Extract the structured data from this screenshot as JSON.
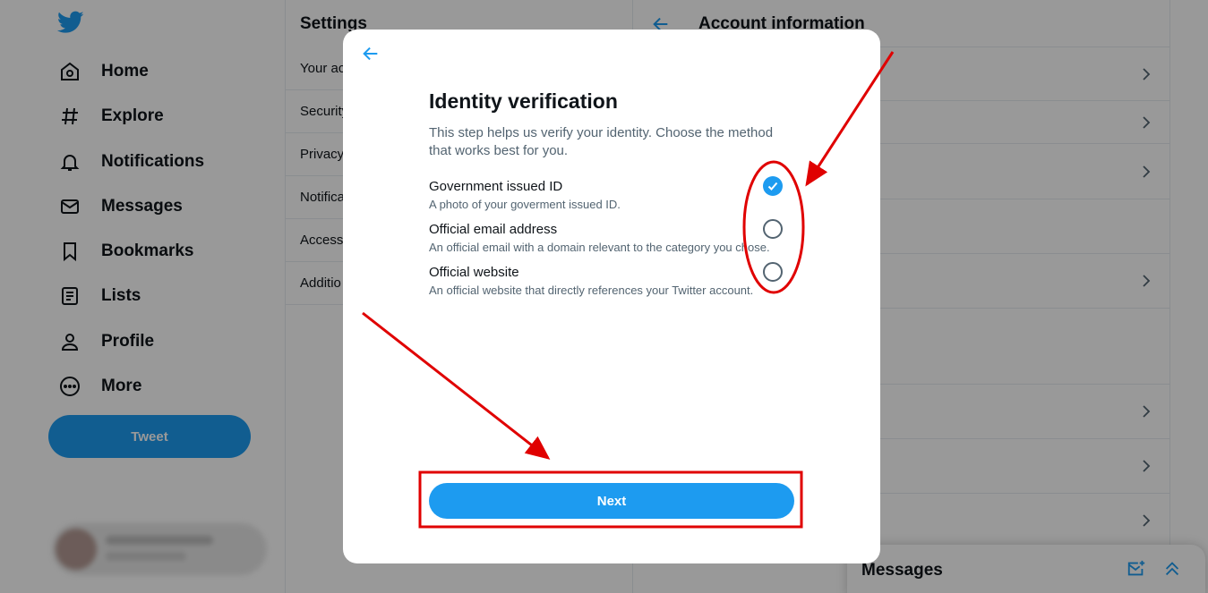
{
  "colors": {
    "accent": "#1d9bf0",
    "annotation": "#e00000",
    "text_secondary": "#536471"
  },
  "nav": {
    "logo_icon": "twitter-bird-icon",
    "items": [
      {
        "label": "Home",
        "icon": "home-icon"
      },
      {
        "label": "Explore",
        "icon": "hashtag-icon"
      },
      {
        "label": "Notifications",
        "icon": "bell-icon"
      },
      {
        "label": "Messages",
        "icon": "envelope-icon"
      },
      {
        "label": "Bookmarks",
        "icon": "bookmark-icon"
      },
      {
        "label": "Lists",
        "icon": "list-icon"
      },
      {
        "label": "Profile",
        "icon": "person-icon"
      },
      {
        "label": "More",
        "icon": "more-circle-icon"
      }
    ],
    "tweet_label": "Tweet"
  },
  "settings": {
    "title": "Settings",
    "items": [
      {
        "label": "Your ac"
      },
      {
        "label": "Security"
      },
      {
        "label": "Privacy"
      },
      {
        "label": "Notifica"
      },
      {
        "label": "Accessi"
      },
      {
        "label": "Additio"
      }
    ]
  },
  "account": {
    "title": "Account information"
  },
  "messages_dock": {
    "title": "Messages"
  },
  "modal": {
    "title": "Identity verification",
    "description": "This step helps us verify your identity. Choose the method that works best for you.",
    "options": [
      {
        "title": "Government issued ID",
        "subtitle": "A photo of your goverment issued ID.",
        "selected": true
      },
      {
        "title": "Official email address",
        "subtitle": "An official email with a domain relevant to the category you chose.",
        "selected": false
      },
      {
        "title": "Official website",
        "subtitle": "An official website that directly references your Twitter account.",
        "selected": false
      }
    ],
    "next_label": "Next"
  }
}
